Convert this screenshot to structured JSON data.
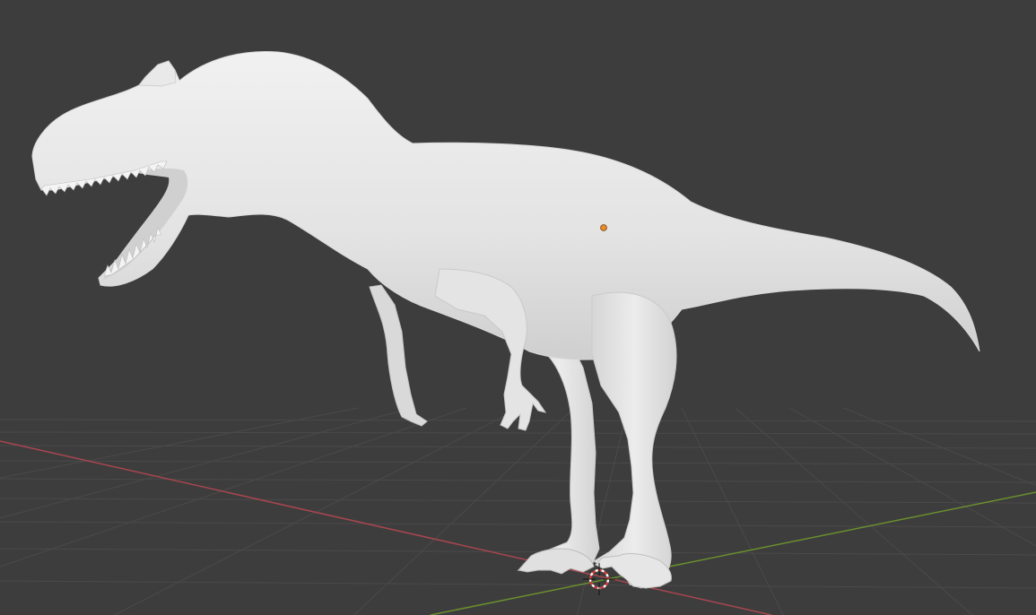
{
  "viewport": {
    "background": "#3d3d3d",
    "grid_color": "#4a4a4a",
    "x_axis_color": "#a8464f",
    "y_axis_color": "#6a8f2e",
    "model_color": "#e8e8e8",
    "origin_color": "#ee8a2a",
    "icons": {
      "model": "dinosaur-mesh",
      "origin": "object-origin-dot",
      "cursor": "3d-cursor"
    }
  }
}
